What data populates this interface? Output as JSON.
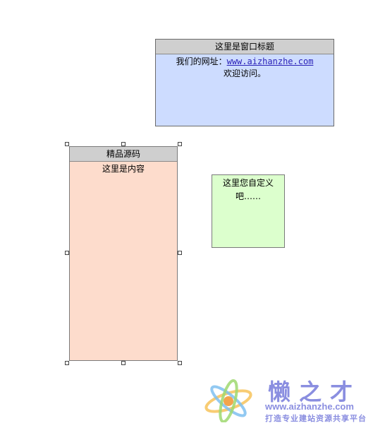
{
  "windows": {
    "main": {
      "title": "这里是窗口标题",
      "site_prefix": "我们的网址：",
      "site_link": "www.aizhanzhe.com",
      "welcome": "欢迎访问。"
    },
    "selected": {
      "title": "精品源码",
      "content": "这里是内容"
    },
    "note": {
      "content": "这里您自定义吧……"
    }
  },
  "watermark": {
    "brand": "懒之才",
    "url": "www.aizhanzhe.com",
    "slogan": "打造专业建站资源共享平台"
  },
  "colors": {
    "title_bar": "#cfcfcf",
    "main_window_bg": "#cddcff",
    "selected_window_bg": "#fddccc",
    "note_window_bg": "#dcffcd",
    "link": "#2b22b8",
    "watermark": "#8a8ee0"
  }
}
